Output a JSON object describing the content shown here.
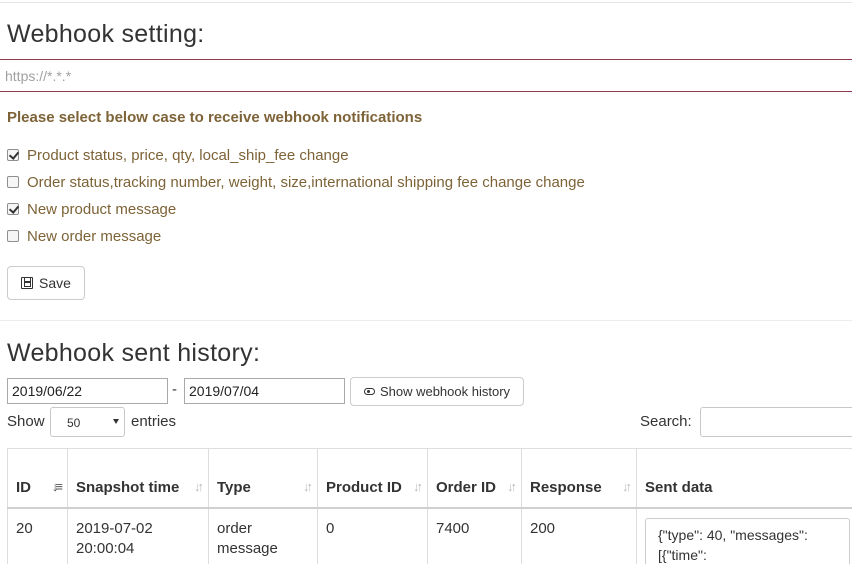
{
  "settings": {
    "title": "Webhook setting:",
    "url_placeholder": "https://*.*.*",
    "instruction": "Please select below case to receive webhook notifications",
    "options": [
      {
        "label": "Product status, price, qty, local_ship_fee change",
        "checked": true
      },
      {
        "label": "Order status,tracking number, weight, size,international shipping fee change change",
        "checked": false
      },
      {
        "label": "New product message",
        "checked": true
      },
      {
        "label": "New order message",
        "checked": false
      }
    ],
    "save_label": "Save"
  },
  "history": {
    "title": "Webhook sent history:",
    "date_from": "2019/06/22",
    "date_sep": "-",
    "date_to": "2019/07/04",
    "show_button": "Show webhook history",
    "show_label": "Show",
    "page_length": "50",
    "entries_label": "entries",
    "search_label": "Search:",
    "columns": [
      {
        "label": "ID",
        "sort": "active"
      },
      {
        "label": "Snapshot time",
        "sort": "both"
      },
      {
        "label": "Type",
        "sort": "both"
      },
      {
        "label": "Product ID",
        "sort": "both"
      },
      {
        "label": "Order ID",
        "sort": "both"
      },
      {
        "label": "Response",
        "sort": "both"
      },
      {
        "label": "Sent data",
        "sort": "none"
      }
    ],
    "rows": [
      {
        "id": "20",
        "snapshot_time": "2019-07-02 20:00:04",
        "type": "order message",
        "product_id": "0",
        "order_id": "7400",
        "response": "200",
        "sent_data": "{\"type\": 40, \"messages\": [{\"time\":"
      }
    ]
  }
}
